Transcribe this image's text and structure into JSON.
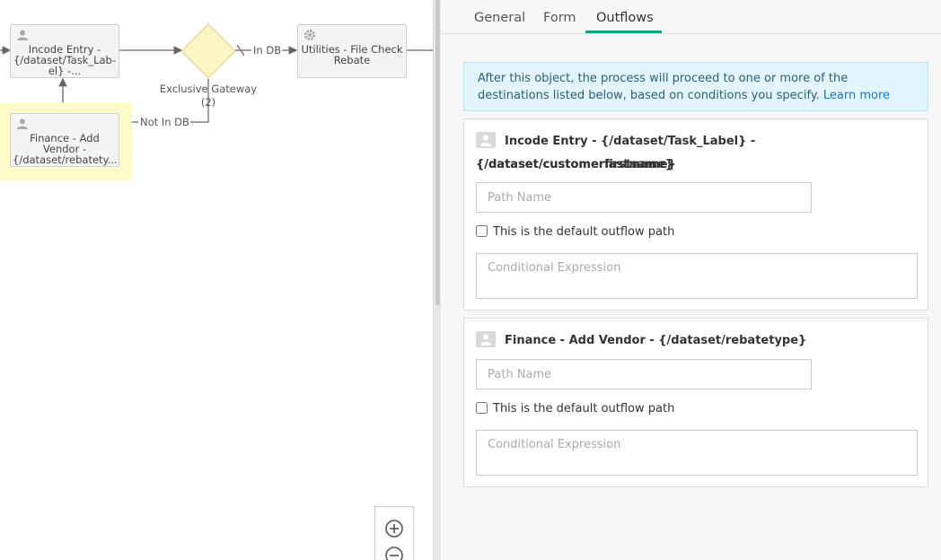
{
  "canvas": {
    "nodes": {
      "incode_entry": "Incode Entry - {/dataset/Task_Lab-el} -...",
      "incode_entry_lines": [
        "Incode Entry -",
        "{/dataset/Task_Lab-",
        "el} -..."
      ],
      "finance_vendor_lines": [
        "Finance - Add",
        "Vendor -",
        "{/dataset/rebatety..."
      ],
      "utilities_lines": [
        "Utilities - File Check",
        "Rebate"
      ]
    },
    "gateway": {
      "label_lines": [
        "Exclusive Gateway",
        "(2)"
      ]
    },
    "connectors": {
      "in_db": "In DB",
      "not_in_db": "Not In DB"
    }
  },
  "panel": {
    "tabs": [
      {
        "label": "General"
      },
      {
        "label": "Form"
      },
      {
        "label": "Outflows",
        "active": true
      }
    ],
    "info_text": "After this object, the process will proceed to one or more of the destinations listed below, based on conditions you specify.",
    "info_link": "Learn more",
    "outflows": [
      {
        "title_line1": "Incode Entry - {/dataset/Task_Label} - {/dataset/customerfirstname}",
        "title_line2": "{/dataset/customerlastname}",
        "path_placeholder": "Path Name",
        "default_label": "This is the default outflow path",
        "cond_placeholder": "Conditional Expression"
      },
      {
        "title_line1": "Finance - Add Vendor - {/dataset/rebatetype}",
        "path_placeholder": "Path Name",
        "default_label": "This is the default outflow path",
        "cond_placeholder": "Conditional Expression"
      }
    ]
  },
  "colors": {
    "accent": "#1aa08a",
    "info_bg": "#e2f5fc",
    "gateway_fill": "#fdf6c3",
    "selection": "#fdfcc8"
  }
}
